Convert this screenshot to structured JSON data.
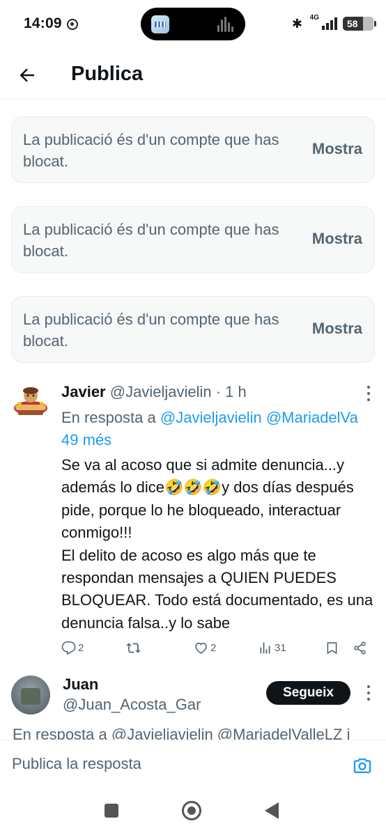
{
  "status_bar": {
    "time": "14:09",
    "network": "4G",
    "battery": "58"
  },
  "header": {
    "title": "Publica"
  },
  "blocked_posts": [
    {
      "text": "La publicació és d'un compte que has blocat.",
      "button": "Mostra"
    },
    {
      "text": "La publicació és d'un compte que has blocat.",
      "button": "Mostra"
    },
    {
      "text": "La publicació és d'un compte que has blocat.",
      "button": "Mostra"
    }
  ],
  "tweet": {
    "name": "Javier",
    "handle": "@Javieljavielin",
    "time": "· 1 h",
    "reply_prefix": "En resposta a",
    "reply_mention_1": "@Javieljavielin",
    "reply_mention_2": "@MariadelVa",
    "reply_more": "49 més",
    "body": "Se va al acoso que si admite denuncia...y además lo dice🤣🤣🤣y dos días después pide, porque lo he bloqueado, interactuar conmigo!!!\nEl delito de acoso es algo más que te respondan mensajes a QUIEN PUEDES BLOQUEAR. Todo está documentado, es una denuncia falsa..y lo sabe",
    "stats": {
      "replies": "2",
      "reposts": "",
      "likes": "2",
      "views": "31"
    }
  },
  "tweet2": {
    "name": "Juan",
    "handle": "@Juan_Acosta_Gar",
    "follow_label": "Segueix",
    "reply_line": "En resposta a @Javieljavielin @MariadelValleLZ i"
  },
  "composer": {
    "placeholder": "Publica la resposta"
  },
  "icons": [
    "back-arrow-icon",
    "more-icon",
    "reply-icon",
    "repost-icon",
    "like-icon",
    "views-icon",
    "bookmark-icon",
    "share-icon",
    "camera-icon"
  ]
}
